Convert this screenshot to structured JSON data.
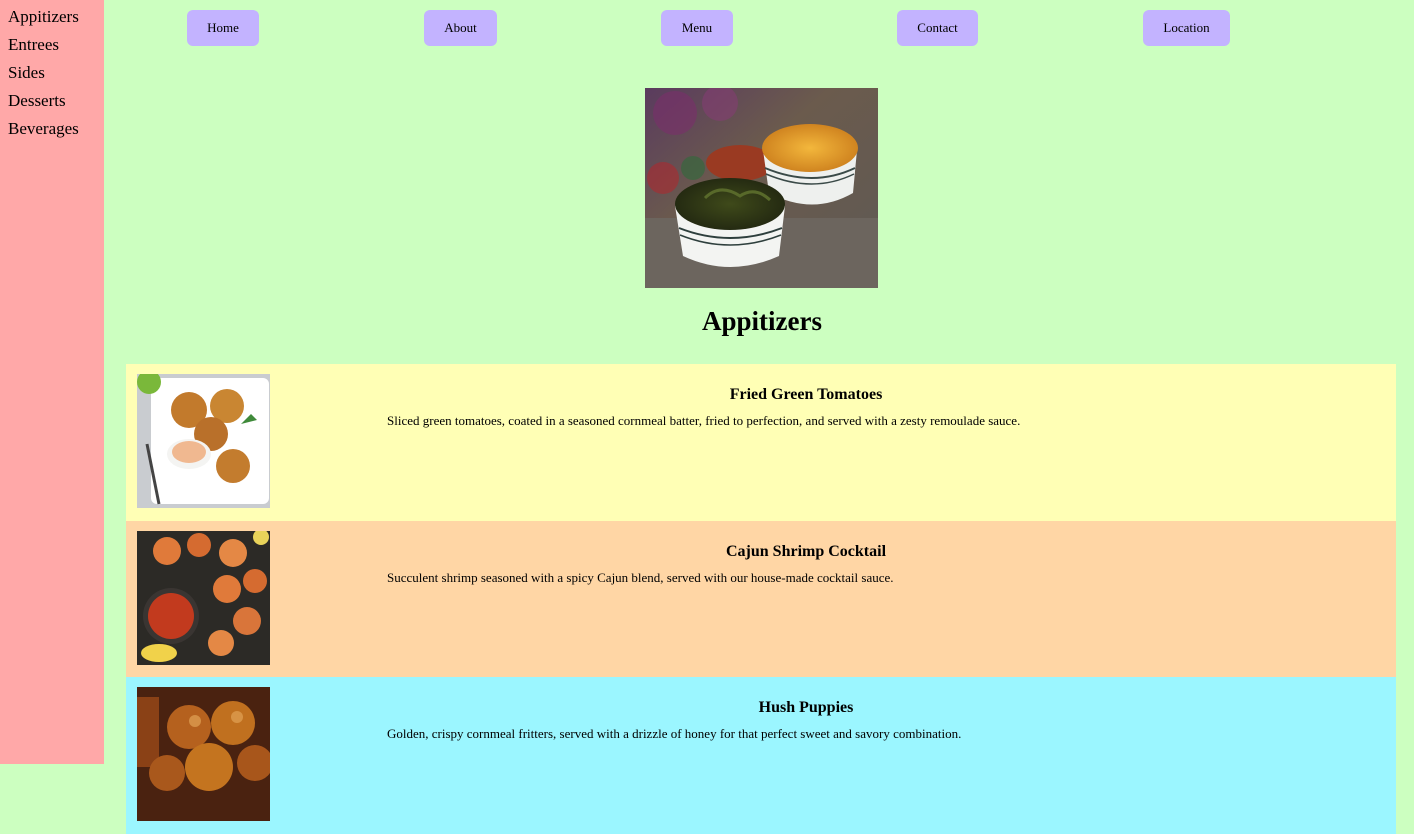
{
  "sidebar": {
    "items": [
      {
        "label": "Appitizers"
      },
      {
        "label": "Entrees"
      },
      {
        "label": "Sides"
      },
      {
        "label": "Desserts"
      },
      {
        "label": "Beverages"
      }
    ]
  },
  "nav": {
    "items": [
      {
        "label": "Home"
      },
      {
        "label": "About"
      },
      {
        "label": "Menu"
      },
      {
        "label": "Contact"
      },
      {
        "label": "Location"
      }
    ]
  },
  "page": {
    "title": "Appitizers"
  },
  "menu_items": [
    {
      "title": "Fried Green Tomatoes",
      "description": "Sliced green tomatoes, coated in a seasoned cornmeal batter, fried to perfection, and served with a zesty remoulade sauce.",
      "background": "#ffffb5"
    },
    {
      "title": "Cajun Shrimp Cocktail",
      "description": "Succulent shrimp seasoned with a spicy Cajun blend, served with our house-made cocktail sauce.",
      "background": "#ffd6a5"
    },
    {
      "title": "Hush Puppies",
      "description": "Golden, crispy cornmeal fritters, served with a drizzle of honey for that perfect sweet and savory combination.",
      "background": "#9bf6ff"
    }
  ],
  "colors": {
    "sidebar_bg": "#ffa8a8",
    "main_bg": "#ccffc0",
    "nav_button_bg": "#c3b3ff"
  }
}
